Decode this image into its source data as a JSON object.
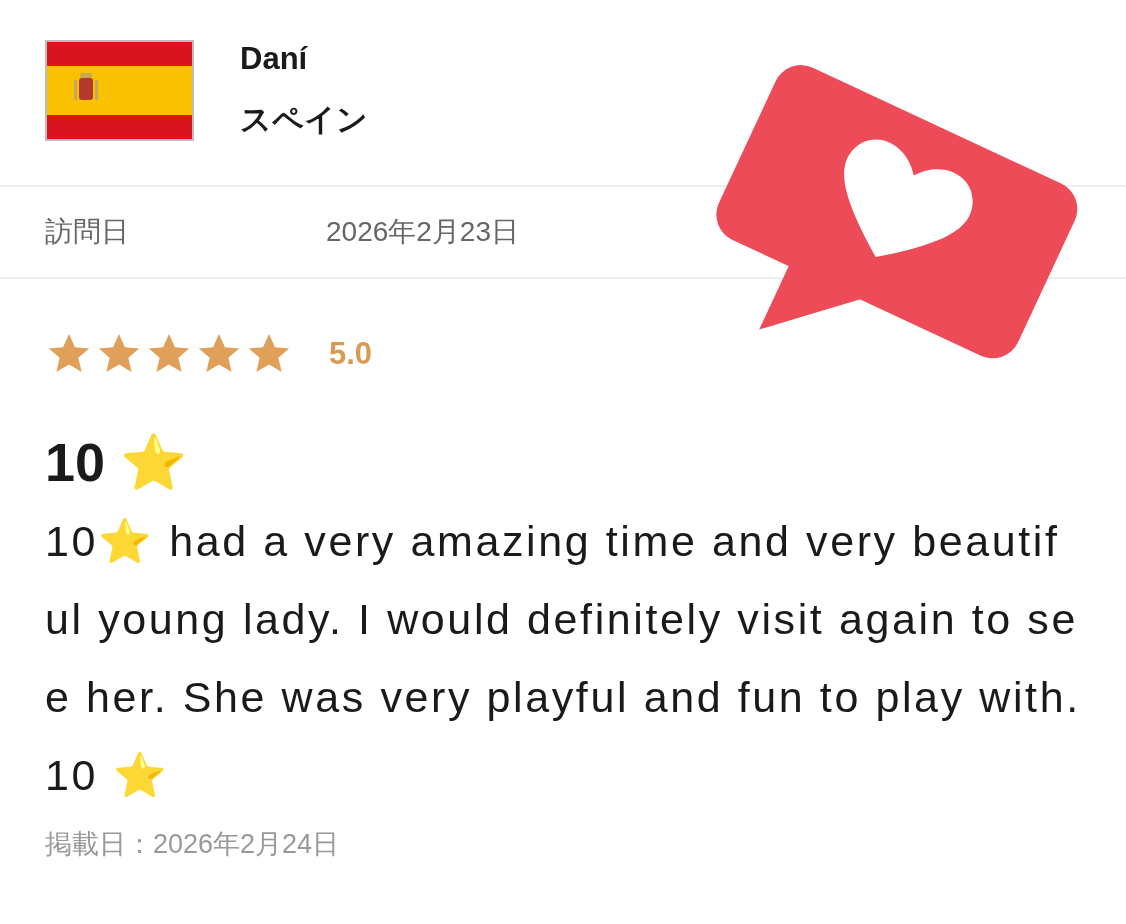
{
  "reviewer": {
    "name": "Daní",
    "country": "スペイン"
  },
  "visit": {
    "label": "訪問日",
    "date": "2026年2月23日"
  },
  "rating": {
    "stars": 5,
    "score": "5.0"
  },
  "review": {
    "title": "10 ⭐",
    "body": "10⭐ had a very amazing time and very beautiful young lady. I would definitely visit again to see her. She was very playful and fun to play with. 10 ⭐",
    "posted": "掲載日：2026年2月24日"
  }
}
